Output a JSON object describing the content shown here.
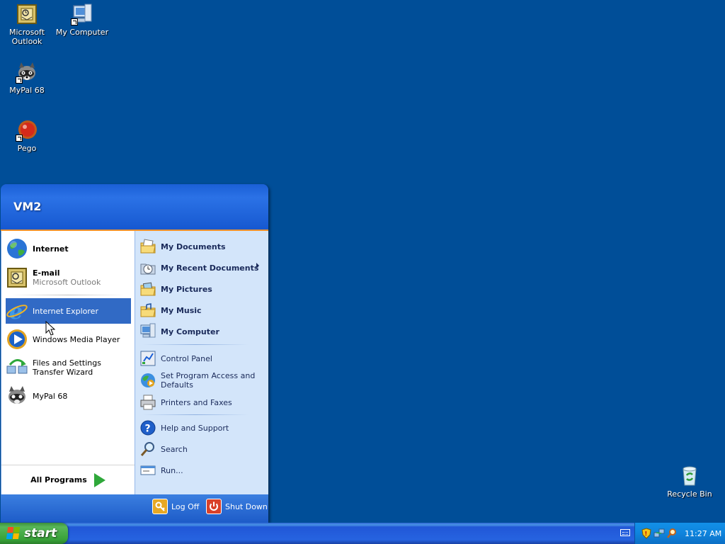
{
  "desktop": {
    "icons": [
      {
        "label": "Microsoft Outlook",
        "icon": "outlook-icon"
      },
      {
        "label": "My Computer",
        "icon": "computer-icon"
      },
      {
        "label": "MyPal 68",
        "icon": "raccoon-icon"
      },
      {
        "label": "Pego",
        "icon": "pego-icon"
      },
      {
        "label": "Recycle Bin",
        "icon": "recycle-bin-icon"
      }
    ]
  },
  "start_menu": {
    "user": "VM2",
    "pinned": [
      {
        "label": "Internet",
        "icon": "globe-icon"
      },
      {
        "label": "E-mail",
        "sublabel": "Microsoft Outlook",
        "icon": "outlook-icon"
      }
    ],
    "recent": [
      {
        "label": "Internet Explorer",
        "icon": "ie-icon",
        "highlighted": true
      },
      {
        "label": "Windows Media Player",
        "icon": "media-player-icon"
      },
      {
        "label": "Files and Settings Transfer Wizard",
        "icon": "transfer-wizard-icon"
      },
      {
        "label": "MyPal 68",
        "icon": "raccoon-icon"
      }
    ],
    "all_programs": "All Programs",
    "places": [
      {
        "label": "My Documents",
        "icon": "folder-icon"
      },
      {
        "label": "My Recent Documents",
        "icon": "recent-docs-icon",
        "submenu": true
      },
      {
        "label": "My Pictures",
        "icon": "folder-icon"
      },
      {
        "label": "My Music",
        "icon": "folder-icon"
      },
      {
        "label": "My Computer",
        "icon": "computer-icon"
      }
    ],
    "settings": [
      {
        "label": "Control Panel",
        "icon": "control-panel-icon"
      },
      {
        "label": "Set Program Access and Defaults",
        "icon": "program-access-icon"
      },
      {
        "label": "Printers and Faxes",
        "icon": "printer-icon"
      }
    ],
    "help": [
      {
        "label": "Help and Support",
        "icon": "help-icon"
      },
      {
        "label": "Search",
        "icon": "search-icon"
      },
      {
        "label": "Run...",
        "icon": "run-icon"
      }
    ],
    "footer": {
      "log_off": "Log Off",
      "shut_down": "Shut Down"
    }
  },
  "taskbar": {
    "start_label": "start",
    "clock": "11:27 AM",
    "tray_icons": [
      "keyboard-icon",
      "security-shield-icon",
      "network-icon",
      "search-tray-icon"
    ]
  },
  "colors": {
    "desktop": "#004e98",
    "highlight": "#316ac5",
    "start_green": "#37a137",
    "menu_right": "#d3e5fa",
    "header_accent": "#f0922c"
  }
}
